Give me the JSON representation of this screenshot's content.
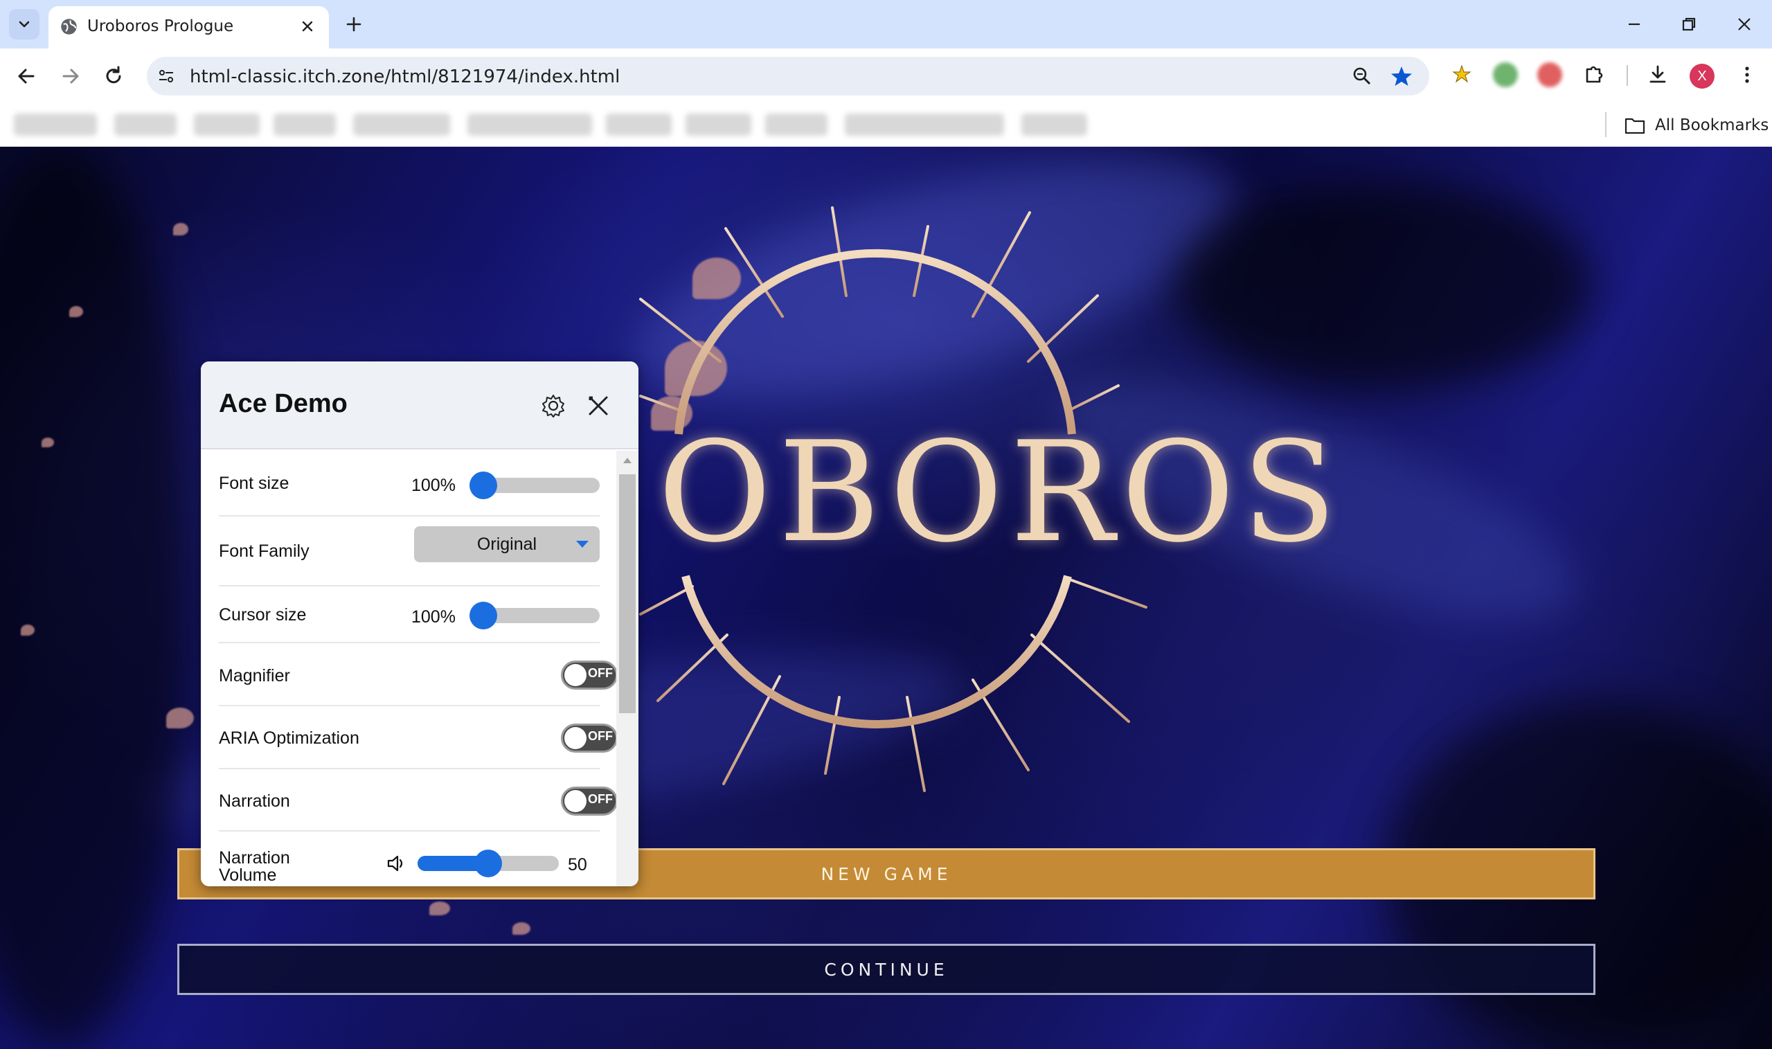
{
  "browser": {
    "tab_title": "Uroboros Prologue",
    "url": "html-classic.itch.zone/html/8121974/index.html",
    "all_bookmarks_label": "All Bookmarks",
    "avatar_letter": "X"
  },
  "game": {
    "logo_text": "OBOROS",
    "new_game_label": "NEW GAME",
    "continue_label": "CONTINUE",
    "colors": {
      "new_game": "#c48a35",
      "logo_gold": "#e8c7a0"
    }
  },
  "panel": {
    "title": "Ace Demo",
    "font_size": {
      "label": "Font size",
      "value": "100%",
      "level": 0
    },
    "font_family": {
      "label": "Font Family",
      "value": "Original"
    },
    "cursor_size": {
      "label": "Cursor size",
      "value": "100%",
      "level": 0
    },
    "magnifier": {
      "label": "Magnifier",
      "state": "OFF"
    },
    "aria": {
      "label": "ARIA Optimization",
      "state": "OFF"
    },
    "narration": {
      "label": "Narration",
      "state": "OFF"
    },
    "narration_volume": {
      "label_line1": "Narration",
      "label_line2": "Volume",
      "value": "50",
      "level": 0.5
    }
  }
}
